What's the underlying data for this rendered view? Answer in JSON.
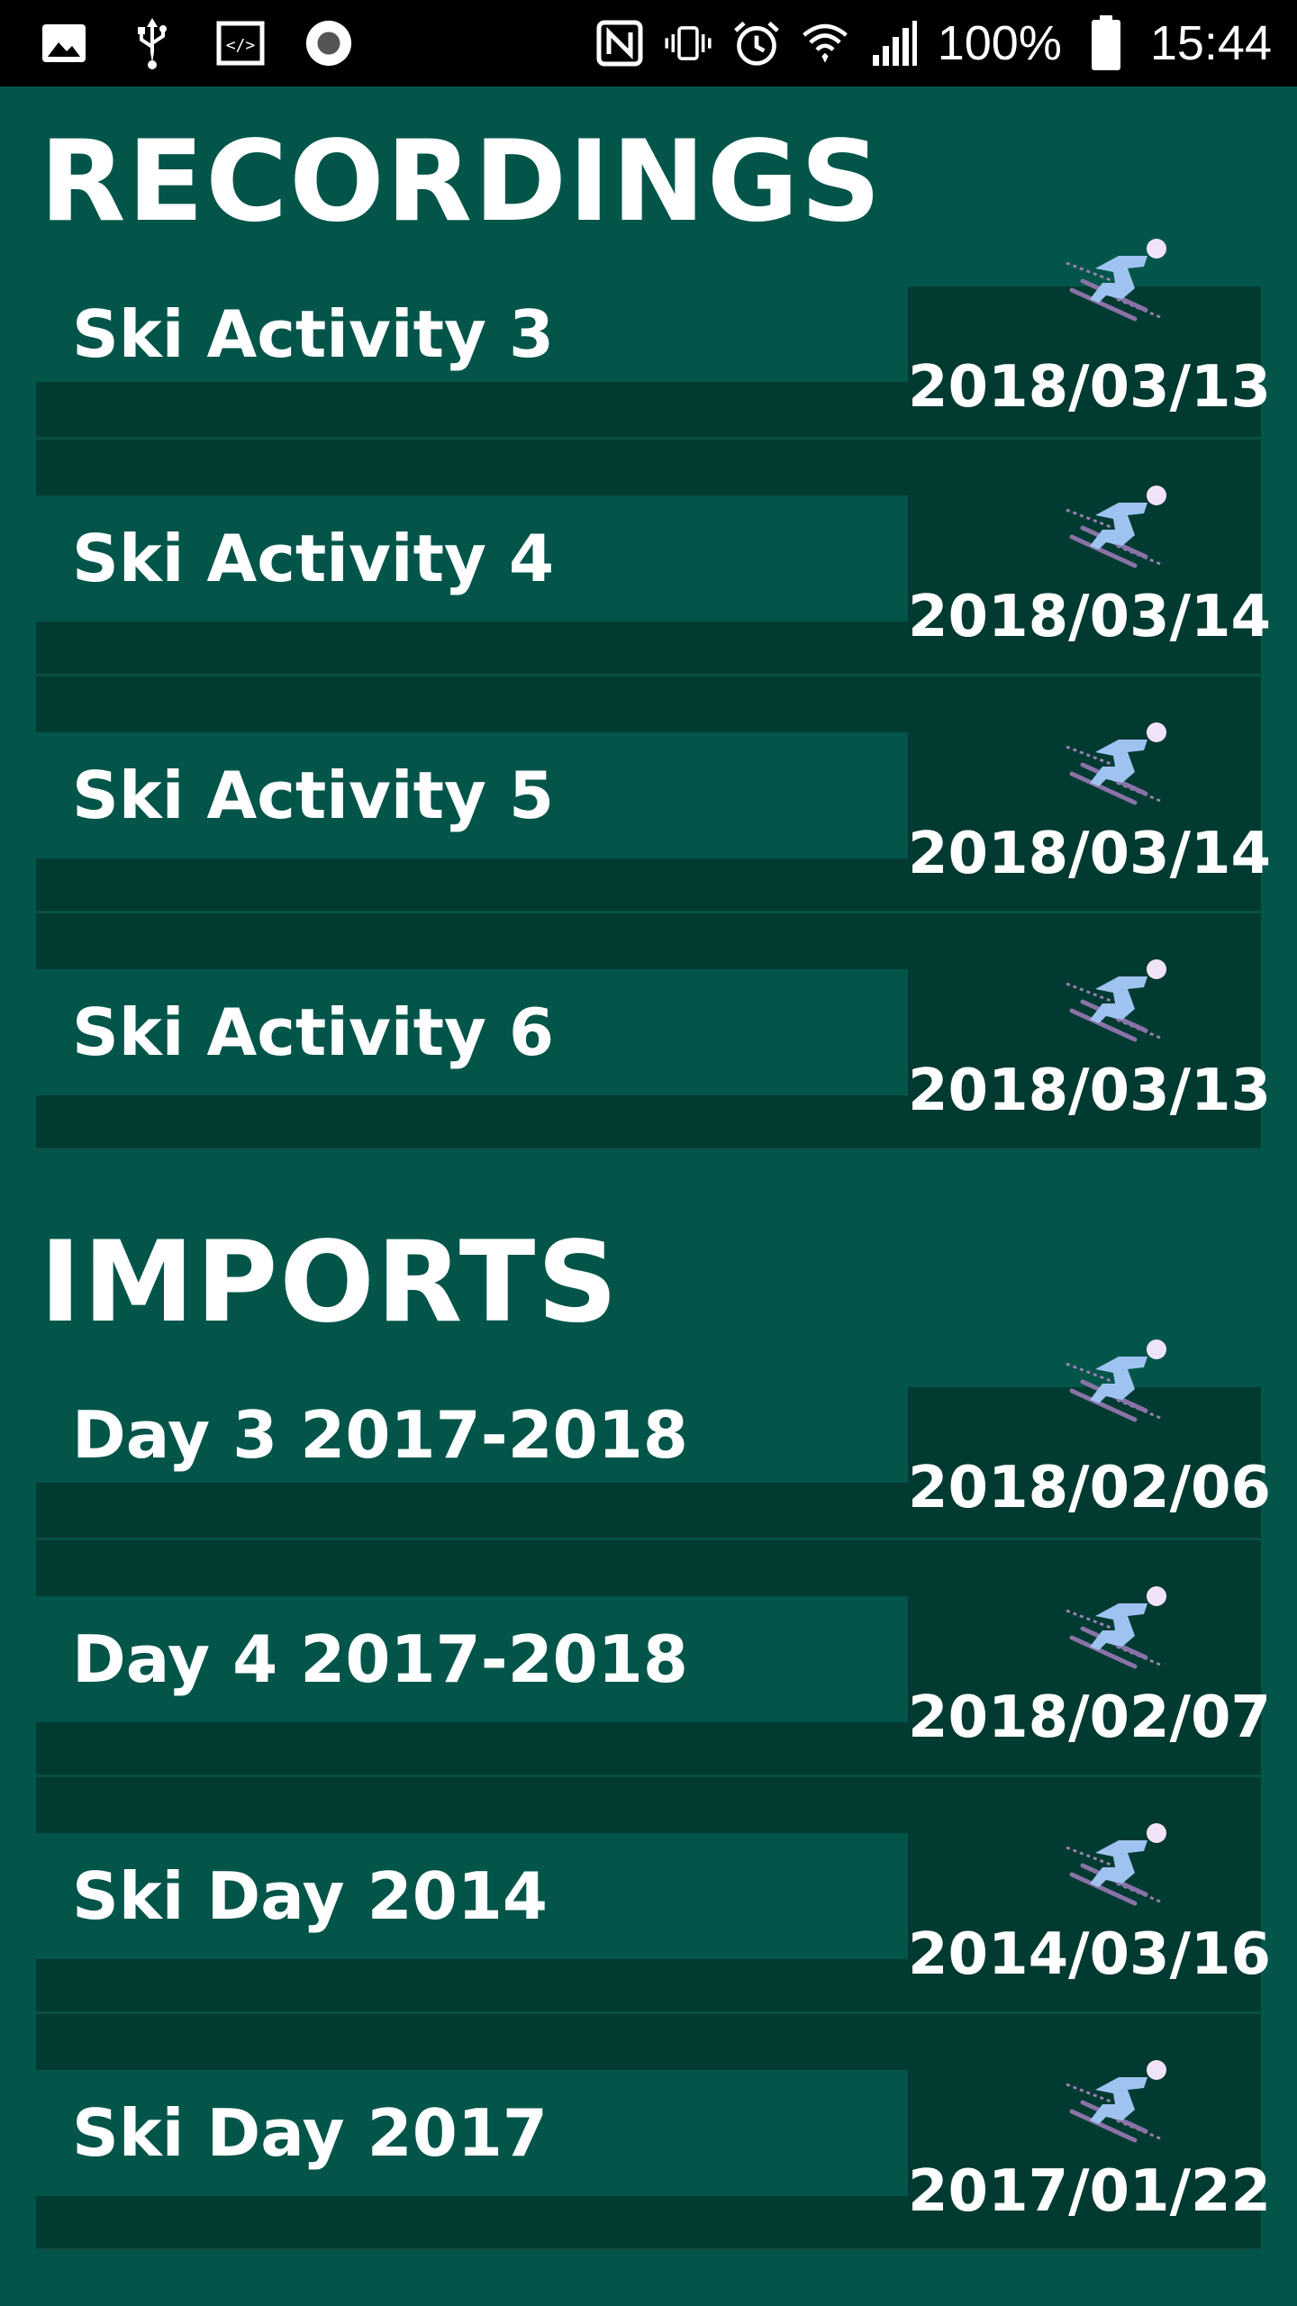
{
  "status_bar": {
    "battery": "100%",
    "time": "15:44",
    "left_icons": [
      "image-icon",
      "usb-icon",
      "developer-mode-icon",
      "record-icon"
    ],
    "right_icons": [
      "nfc-icon",
      "vibrate-icon",
      "alarm-icon",
      "wifi-icon",
      "signal-icon",
      "battery-icon"
    ]
  },
  "recordings": {
    "title": "RECORDINGS",
    "items": [
      {
        "name": "Ski Activity 3",
        "date": "2018/03/13"
      },
      {
        "name": "Ski Activity 4",
        "date": "2018/03/14"
      },
      {
        "name": "Ski Activity 5",
        "date": "2018/03/14"
      },
      {
        "name": "Ski Activity 6",
        "date": "2018/03/13"
      }
    ]
  },
  "imports": {
    "title": "IMPORTS",
    "items": [
      {
        "name": "Day 3 2017-2018",
        "date": "2018/02/06"
      },
      {
        "name": "Day 4 2017-2018",
        "date": "2018/02/07"
      },
      {
        "name": "Ski Day 2014",
        "date": "2014/03/16"
      },
      {
        "name": "Ski Day 2017",
        "date": "2017/01/22"
      }
    ]
  },
  "colors": {
    "background": "#03554A",
    "row_dark": "#013A31",
    "skier_icon": "#9FC3F0"
  },
  "row_icon": "skier-icon"
}
